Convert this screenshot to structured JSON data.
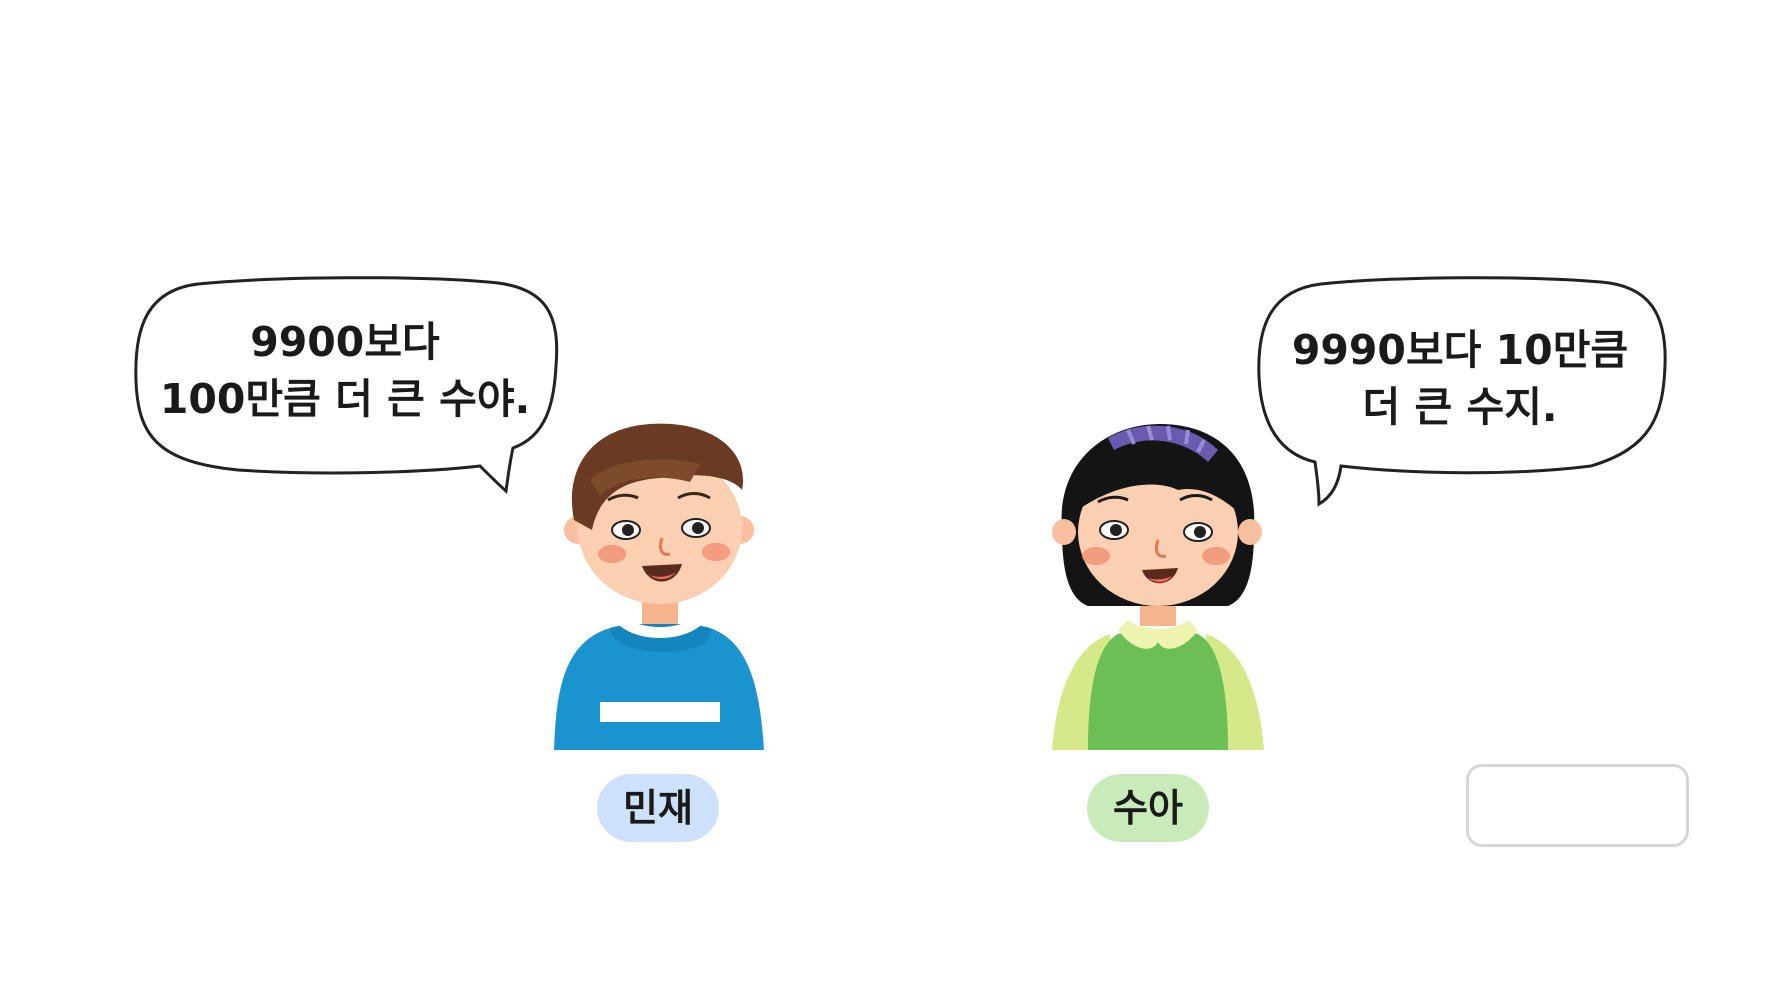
{
  "colors": {
    "background": "#ffffff",
    "minjae_label_bg": "#cde2fa",
    "sua_label_bg": "#c8ebba",
    "bubble_stroke": "#222222",
    "answer_box_border": "#d6d6d6"
  },
  "minjae": {
    "name": "민재",
    "speech_line1": "9900보다",
    "speech_line2": "100만큼 더 큰 수야."
  },
  "sua": {
    "name": "수아",
    "speech_line1": "9990보다 10만큼",
    "speech_line2": "더 큰 수지."
  },
  "answer_box": {
    "value": ""
  }
}
